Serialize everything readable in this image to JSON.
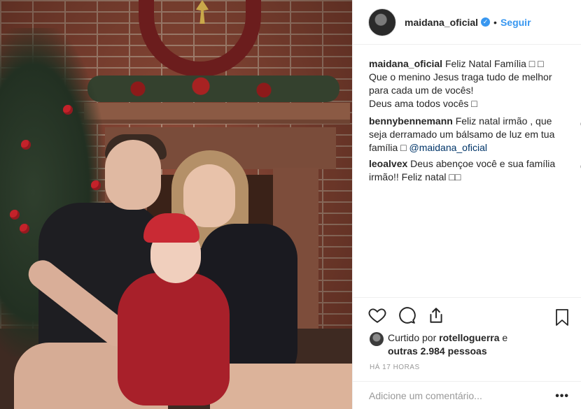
{
  "post": {
    "author": {
      "username": "maidana_oficial",
      "verified": true,
      "follow_label": "Seguir",
      "separator": "•"
    },
    "caption": {
      "username": "maidana_oficial",
      "lines": [
        "Feliz Natal Família □ □",
        "Que o menino Jesus traga tudo de melhor para cada um de vocês!",
        "Deus ama todos vocês □"
      ]
    },
    "comments": [
      {
        "username": "bennybennemann",
        "text": "Feliz natal irmão , que seja derramado um bálsamo de luz em tua família □",
        "mention": "@maidana_oficial"
      },
      {
        "username": "leoalvex",
        "text": "Deus abençoe você e sua família irmão!! Feliz natal □□"
      }
    ],
    "likes": {
      "prefix": "Curtido por",
      "user": "rotelloguerra",
      "conj": "e",
      "others": "outras 2.984 pessoas"
    },
    "time_ago": "HÁ 17 HORAS",
    "add_comment_placeholder": "Adicione um comentário...",
    "more_label": "•••",
    "icons": {
      "like": "heart-icon",
      "comment": "comment-bubble-icon",
      "share": "share-icon",
      "save": "bookmark-icon",
      "verified": "verified-badge-icon"
    },
    "colors": {
      "accent": "#3897f0",
      "text": "#262626",
      "muted": "#999999",
      "mention": "#003569"
    }
  }
}
